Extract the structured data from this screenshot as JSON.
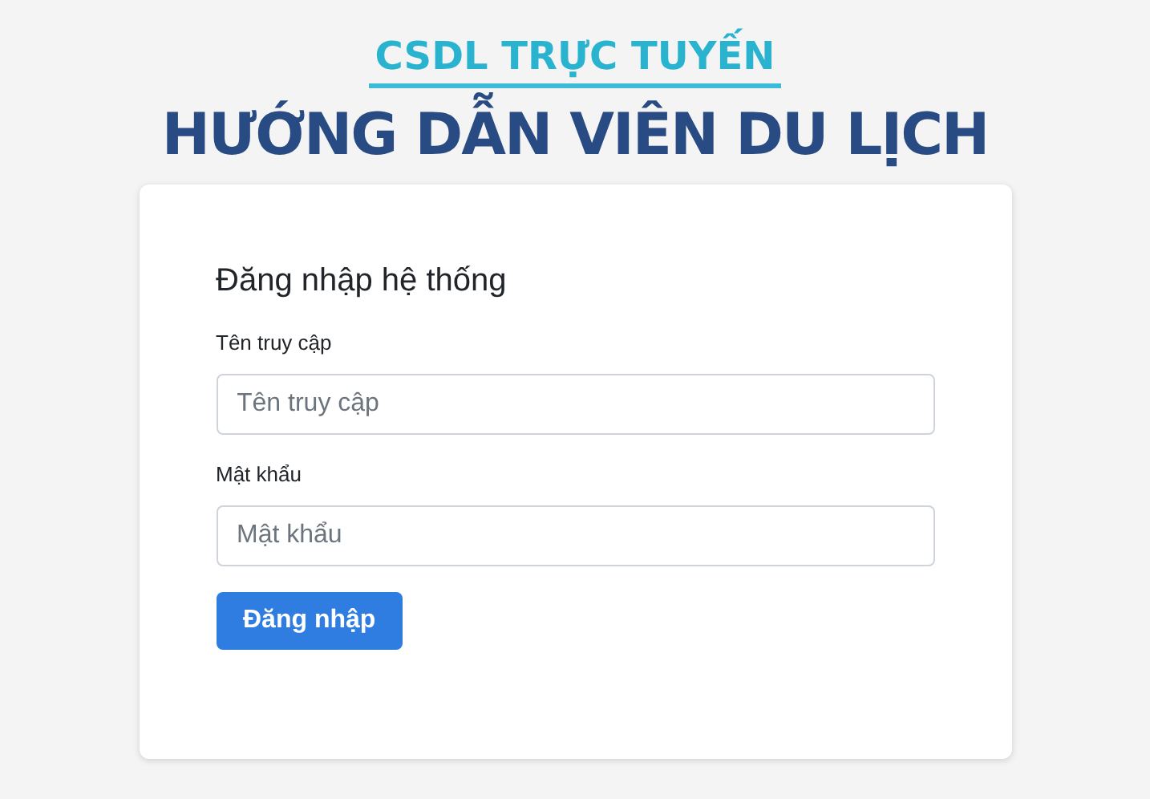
{
  "logo": {
    "subtitle": "CSDL TRỰC TUYẾN",
    "title": "HƯỚNG DẪN VIÊN DU LỊCH"
  },
  "login": {
    "heading": "Đăng nhập hệ thống",
    "fields": [
      {
        "label": "Tên truy cập",
        "placeholder": "Tên truy cập"
      },
      {
        "label": "Mật khẩu",
        "placeholder": "Mật khẩu"
      }
    ],
    "button": "Đăng nhập"
  }
}
